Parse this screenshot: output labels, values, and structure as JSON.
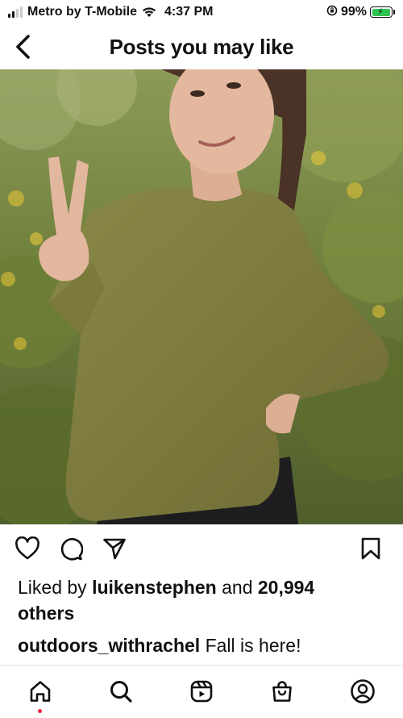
{
  "status_bar": {
    "carrier": "Metro by T-Mobile",
    "time": "4:37 PM",
    "battery_percent": "99%",
    "battery_level": 0.99,
    "signal_bars_filled": 2,
    "signal_bars_total": 4
  },
  "header": {
    "title": "Posts you may like",
    "back_icon": "chevron-left-icon"
  },
  "post": {
    "image_description_icon": "photo",
    "actions": {
      "like_icon": "heart-icon",
      "comment_icon": "comment-icon",
      "share_icon": "send-icon",
      "save_icon": "bookmark-icon"
    },
    "likes": {
      "prefix": "Liked by ",
      "user": "luikenstephen",
      "middle": " and ",
      "count": "20,994",
      "suffix": "others"
    },
    "caption": {
      "username": "outdoors_withrachel",
      "text": " Fall is here!"
    }
  },
  "tab_bar": {
    "tabs": [
      "home-icon",
      "search-icon",
      "reels-icon",
      "shop-icon",
      "profile-icon"
    ],
    "active_dot_color": "#ed1c45"
  },
  "colors": {
    "battery_fill": "#2fc552",
    "shirt": "#7d7a3c"
  }
}
